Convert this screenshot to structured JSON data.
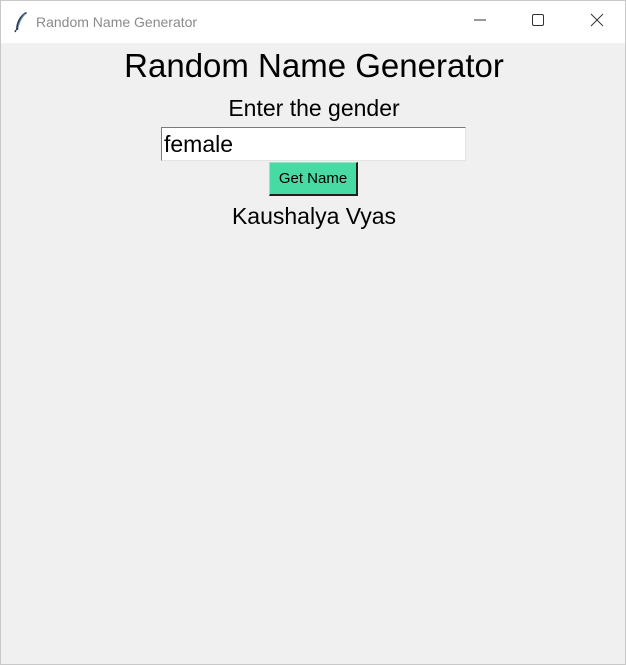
{
  "window": {
    "title": "Random Name Generator",
    "icon": "feather-icon",
    "controls": [
      "minimize-icon",
      "maximize-icon",
      "close-icon"
    ]
  },
  "app": {
    "heading": "Random Name Generator",
    "prompt": "Enter the gender",
    "gender_input_value": "female",
    "button_label": "Get Name",
    "result_name": "Kaushalya Vyas"
  },
  "colors": {
    "background": "#f0f0f0",
    "titlebar": "#ffffff",
    "button": "#47dba3"
  }
}
